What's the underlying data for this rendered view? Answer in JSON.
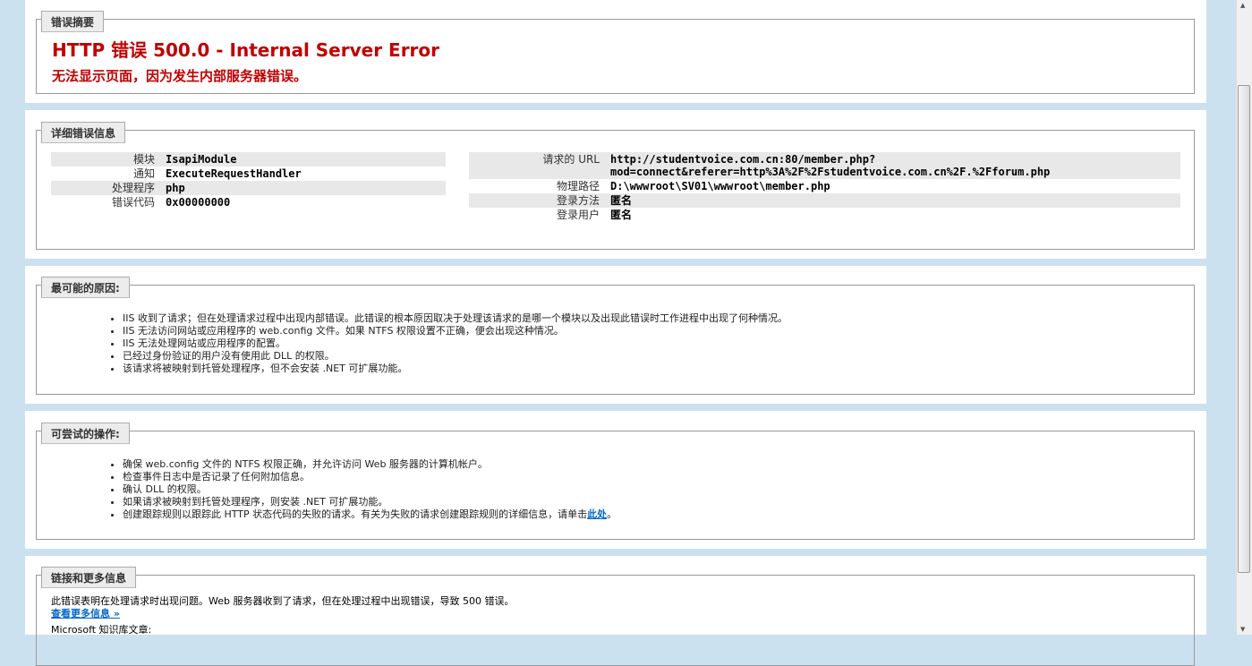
{
  "summary": {
    "legend": "错误摘要",
    "title": "HTTP 错误 500.0 - Internal Server Error",
    "subtitle": "无法显示页面，因为发生内部服务器错误。"
  },
  "detail": {
    "legend": "详细错误信息",
    "left": [
      {
        "k": "模块",
        "v": "IsapiModule"
      },
      {
        "k": "通知",
        "v": "ExecuteRequestHandler"
      },
      {
        "k": "处理程序",
        "v": "php"
      },
      {
        "k": "错误代码",
        "v": "0x00000000"
      }
    ],
    "right": [
      {
        "k": "请求的 URL",
        "v": "http://studentvoice.com.cn:80/member.php?",
        "v2": "mod=connect&referer=http%3A%2F%2Fstudentvoice.com.cn%2F.%2Fforum.php"
      },
      {
        "k": "物理路径",
        "v": "D:\\wwwroot\\SV01\\wwwroot\\member.php"
      },
      {
        "k": "登录方法",
        "v": "匿名"
      },
      {
        "k": "登录用户",
        "v": "匿名"
      }
    ]
  },
  "causes": {
    "legend": "最可能的原因:",
    "items": [
      "IIS 收到了请求；但在处理请求过程中出现内部错误。此错误的根本原因取决于处理该请求的是哪一个模块以及出现此错误时工作进程中出现了何种情况。",
      "IIS 无法访问网站或应用程序的 web.config 文件。如果 NTFS 权限设置不正确，便会出现这种情况。",
      "IIS 无法处理网站或应用程序的配置。",
      "已经过身份验证的用户没有使用此 DLL 的权限。",
      "该请求将被映射到托管处理程序，但不会安装 .NET 可扩展功能。"
    ]
  },
  "actions": {
    "legend": "可尝试的操作:",
    "items": [
      "确保 web.config 文件的 NTFS 权限正确，并允许访问 Web 服务器的计算机帐户。",
      "检查事件日志中是否记录了任何附加信息。",
      "确认 DLL 的权限。",
      "如果请求被映射到托管处理程序，则安装 .NET 可扩展功能。"
    ],
    "last": "创建跟踪规则以跟踪此 HTTP 状态代码的失败的请求。有关为失败的请求创建跟踪规则的详细信息，请单击",
    "link": "此处",
    "end": "。"
  },
  "more": {
    "legend": "链接和更多信息",
    "text": "此错误表明在处理请求时出现问题。Web 服务器收到了请求，但在处理过程中出现错误，导致 500 错误。",
    "link": "查看更多信息 »",
    "kb": "Microsoft 知识库文章:"
  }
}
